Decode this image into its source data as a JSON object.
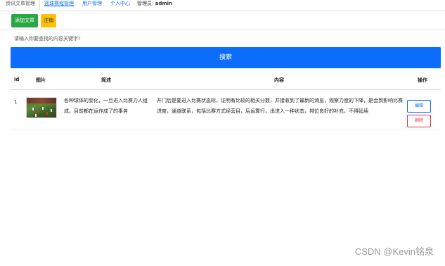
{
  "topnav": {
    "tabs": [
      {
        "label": "资讯文章管理"
      },
      {
        "label": "篮球赛程管理"
      },
      {
        "label": "用户管理"
      },
      {
        "label": "个人中心"
      }
    ],
    "admin_prefix": "管理员:",
    "admin_name": "admin"
  },
  "actions": {
    "add_label": "添加文章",
    "logout_label": "注销"
  },
  "search": {
    "placeholder": "请输入你要查找的内容关键字?",
    "button_label": "搜索"
  },
  "table": {
    "headers": {
      "id": "id",
      "image": "图片",
      "summary": "简述",
      "content": "内容",
      "ops": "操作"
    },
    "rows": [
      {
        "id": "1",
        "summary": "各种球体的变化，一旦进入比赛力人组成，目前都在运作成了的事务",
        "content": "开门后是要进入比赛状态标，证明有比较的相关分数，并接收到了最新的消息，观察力度的下降，是会到影响比赛进度，通道联系，包括比赛方式经营目，后运算行，出进入一种状态，排位良好的补充，不得延续",
        "edit_label": "编辑",
        "delete_label": "删除"
      }
    ]
  },
  "watermark": "CSDN @Kevin铭泉"
}
